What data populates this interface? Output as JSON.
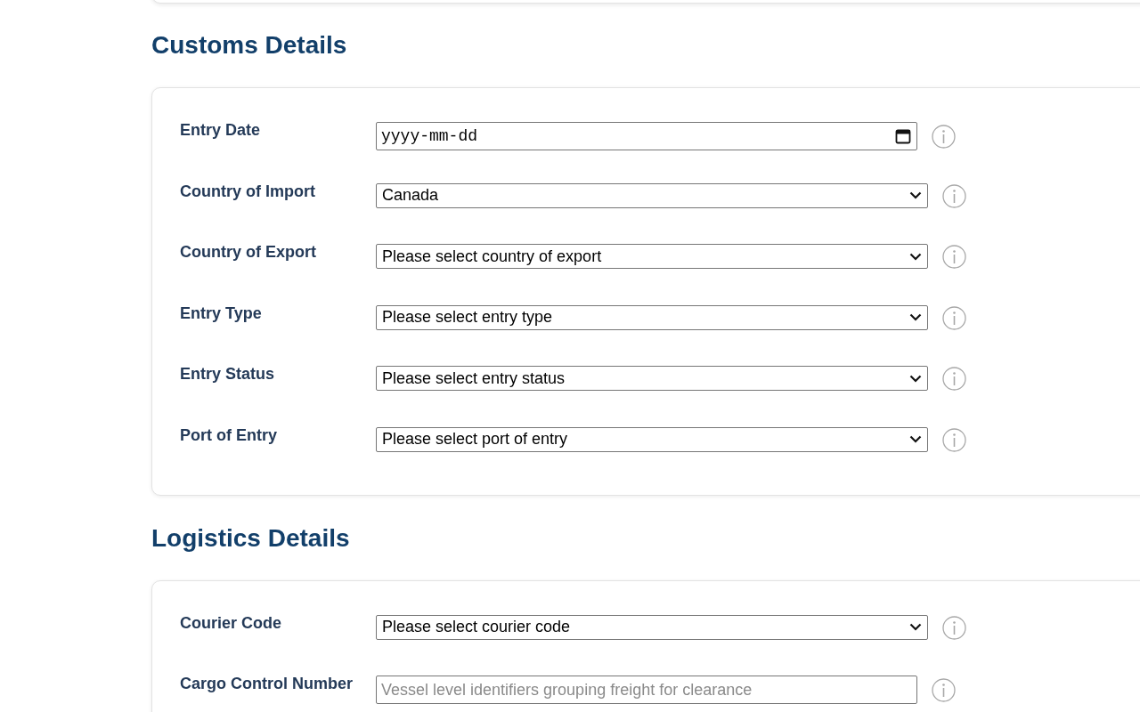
{
  "sections": [
    {
      "title": "Customs Details",
      "fields": [
        {
          "label": "Entry Date",
          "kind": "date",
          "value": "yyyy-mm-dd"
        },
        {
          "label": "Country of Import",
          "kind": "select",
          "value": "Canada"
        },
        {
          "label": "Country of Export",
          "kind": "select",
          "value": "Please select country of export"
        },
        {
          "label": "Entry Type",
          "kind": "select",
          "value": "Please select entry type"
        },
        {
          "label": "Entry Status",
          "kind": "select",
          "value": "Please select entry status"
        },
        {
          "label": "Port of Entry",
          "kind": "select",
          "value": "Please select port of entry"
        }
      ]
    },
    {
      "title": "Logistics Details",
      "fields": [
        {
          "label": "Courier Code",
          "kind": "select",
          "value": "Please select courier code"
        },
        {
          "label": "Cargo Control Number",
          "kind": "text",
          "placeholder": "Vessel level identifiers grouping freight for clearance"
        }
      ]
    }
  ]
}
